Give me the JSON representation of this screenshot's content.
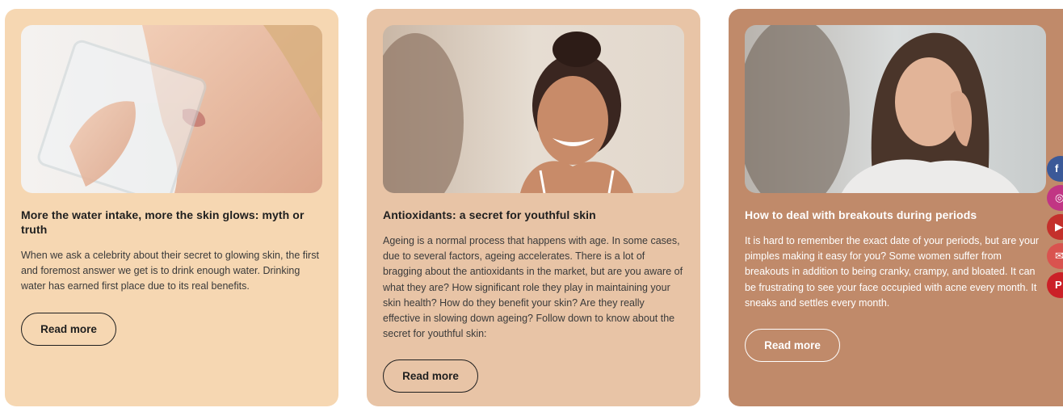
{
  "cards": [
    {
      "title": "More the water intake, more the skin glows: myth or truth",
      "body": "When we ask a celebrity about their secret to glowing skin, the first and foremost answer we get is to drink enough water. Drinking water has earned first place due to its real benefits.",
      "button": "Read more",
      "image": "woman-drinking-water-photo",
      "bg": "#f6d7b2"
    },
    {
      "title": "Antioxidants: a secret for youthful skin",
      "body": "Ageing is a normal process that happens with age. In some cases, due to several factors, ageing accelerates. There is a lot of bragging about the antioxidants in the market, but are you aware of what they are? How significant role they play in maintaining your skin health? How do they benefit your skin? Are they really effective in slowing down ageing? Follow down to know about the secret for youthful skin:",
      "button": "Read more",
      "image": "smiling-woman-mirror-photo",
      "bg": "#e8c4a6"
    },
    {
      "title": "How to deal with breakouts during periods",
      "body": "It is hard to remember the exact date of your periods, but are your pimples making it easy for you? Some women suffer from breakouts in addition to being cranky, crampy, and bloated. It can be frustrating to see your face occupied with acne every month. It sneaks and settles every month.",
      "button": "Read more",
      "image": "worried-woman-touching-face-photo",
      "bg": "#c08a6a"
    }
  ],
  "social": [
    {
      "icon": "facebook-icon",
      "glyph": "f",
      "color": "#3b5998"
    },
    {
      "icon": "instagram-icon",
      "glyph": "◎",
      "color": "#c13584"
    },
    {
      "icon": "youtube-icon",
      "glyph": "▶",
      "color": "#c4302b"
    },
    {
      "icon": "mail-icon",
      "glyph": "✉",
      "color": "#d9534f"
    },
    {
      "icon": "pinterest-icon",
      "glyph": "P",
      "color": "#cb2027"
    }
  ]
}
